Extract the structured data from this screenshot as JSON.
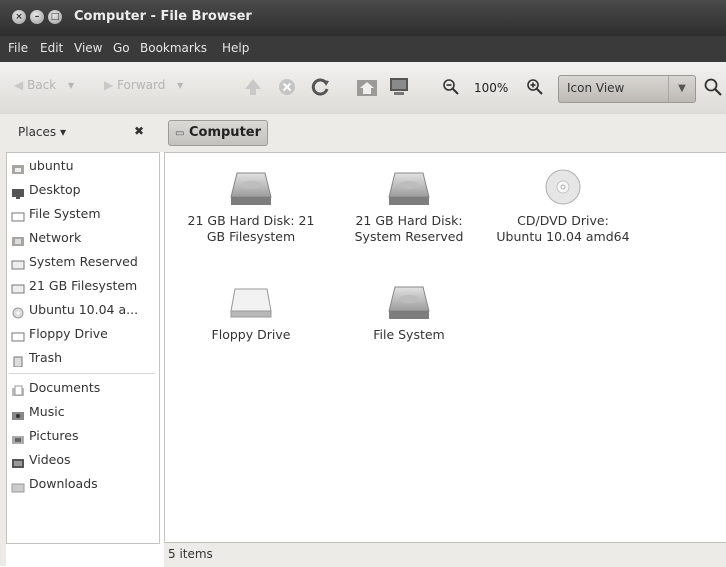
{
  "window": {
    "title": "Computer - File Browser",
    "buttons": [
      "close-icon",
      "minimize-icon",
      "maximize-icon"
    ]
  },
  "menubar": {
    "items": [
      "File",
      "Edit",
      "View",
      "Go",
      "Bookmarks",
      "Help"
    ]
  },
  "toolbar": {
    "back_label": "Back",
    "forward_label": "Forward",
    "zoom_level": "100%",
    "view_mode": "Icon View",
    "icons": [
      "back-arrow-icon",
      "forward-arrow-icon",
      "up-arrow-icon",
      "stop-icon",
      "reload-icon",
      "home-icon",
      "computer-icon",
      "zoom-out-icon",
      "zoom-in-icon",
      "search-icon"
    ]
  },
  "places": {
    "header": "Places ▾",
    "close_glyph": "✖"
  },
  "location": {
    "current": "Computer"
  },
  "sidebar": {
    "items": [
      {
        "label": "ubuntu",
        "icon": "home-folder-icon"
      },
      {
        "label": "Desktop",
        "icon": "desktop-icon"
      },
      {
        "label": "File System",
        "icon": "drive-icon"
      },
      {
        "label": "Network",
        "icon": "network-icon"
      },
      {
        "label": "System Reserved",
        "icon": "drive-icon"
      },
      {
        "label": "21 GB Filesystem",
        "icon": "drive-icon"
      },
      {
        "label": "Ubuntu 10.04 a...",
        "icon": "cd-icon"
      },
      {
        "label": "Floppy Drive",
        "icon": "floppy-icon"
      },
      {
        "label": "Trash",
        "icon": "trash-icon"
      },
      {
        "label": "Documents",
        "icon": "folder-icon"
      },
      {
        "label": "Music",
        "icon": "music-folder-icon"
      },
      {
        "label": "Pictures",
        "icon": "pictures-folder-icon"
      },
      {
        "label": "Videos",
        "icon": "videos-folder-icon"
      },
      {
        "label": "Downloads",
        "icon": "downloads-folder-icon"
      }
    ]
  },
  "files": [
    {
      "label": "21 GB Hard Disk: 21 GB Filesystem",
      "icon": "hard-disk-icon"
    },
    {
      "label": "21 GB Hard Disk: System Reserved",
      "icon": "hard-disk-icon"
    },
    {
      "label": "CD/DVD Drive: Ubuntu 10.04 amd64",
      "icon": "cd-dvd-icon"
    },
    {
      "label": "Floppy Drive",
      "icon": "floppy-drive-icon"
    },
    {
      "label": "File System",
      "icon": "hard-disk-icon"
    }
  ],
  "status": {
    "text": "5 items"
  }
}
